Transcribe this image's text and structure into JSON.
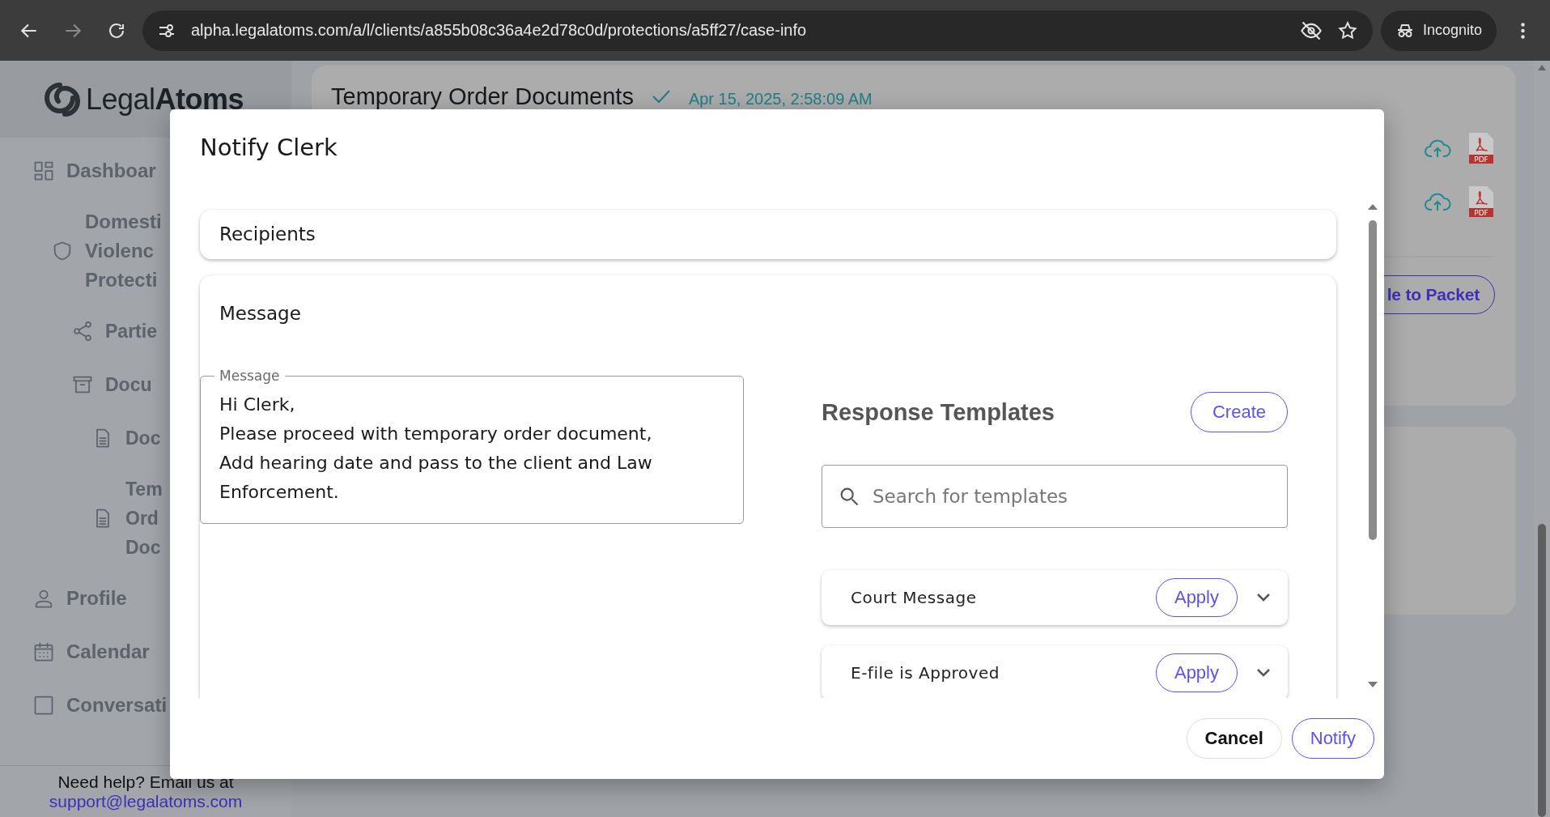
{
  "browser": {
    "url": "alpha.legalatoms.com/a/l/clients/a855b08c36a4e2d78c0d/protections/a5ff27/case-info",
    "profile": "Incognito"
  },
  "sidebar": {
    "logo": {
      "light": "Legal",
      "bold": "Atoms"
    },
    "items": [
      {
        "lines": [
          "Dashboar"
        ]
      },
      {
        "lines": [
          "Domesti",
          "Violenc",
          "Protecti"
        ],
        "children": [
          {
            "lines": [
              "Partie"
            ]
          },
          {
            "lines": [
              "Docu"
            ],
            "children": [
              {
                "lines": [
                  "Doc"
                ]
              },
              {
                "lines": [
                  "Tem",
                  "Ord",
                  "Doc"
                ]
              }
            ]
          }
        ]
      },
      {
        "lines": [
          "Profile"
        ]
      },
      {
        "lines": [
          "Calendar"
        ]
      },
      {
        "lines": [
          "Conversati"
        ]
      }
    ],
    "help": {
      "text": "Need help? Email us at",
      "link": "support@legalatoms.com"
    }
  },
  "content": {
    "title": "Temporary Order Documents",
    "saved_at": "Apr 15, 2025, 2:58:09 AM",
    "files": [
      {
        "badge": "PDF"
      },
      {
        "badge": "PDF"
      }
    ],
    "packet_button": "le to Packet"
  },
  "modal": {
    "title": "Notify Clerk",
    "recipients": {
      "heading": "Recipients"
    },
    "message": {
      "heading": "Message",
      "field_label": "Message",
      "value": "Hi Clerk,\nPlease proceed with temporary order document,\nAdd hearing date and pass to the client and Law\nEnforcement."
    },
    "templates": {
      "title": "Response Templates",
      "create": "Create",
      "search_placeholder": "Search for templates",
      "items": [
        {
          "name": "Court Message",
          "action": "Apply",
          "expanded": false
        },
        {
          "name": "E-file is Approved",
          "action": "Apply",
          "expanded": false
        }
      ]
    },
    "buttons": [
      {
        "label": "Cancel",
        "kind": "secondary"
      },
      {
        "label": "Notify",
        "kind": "primary"
      }
    ]
  }
}
